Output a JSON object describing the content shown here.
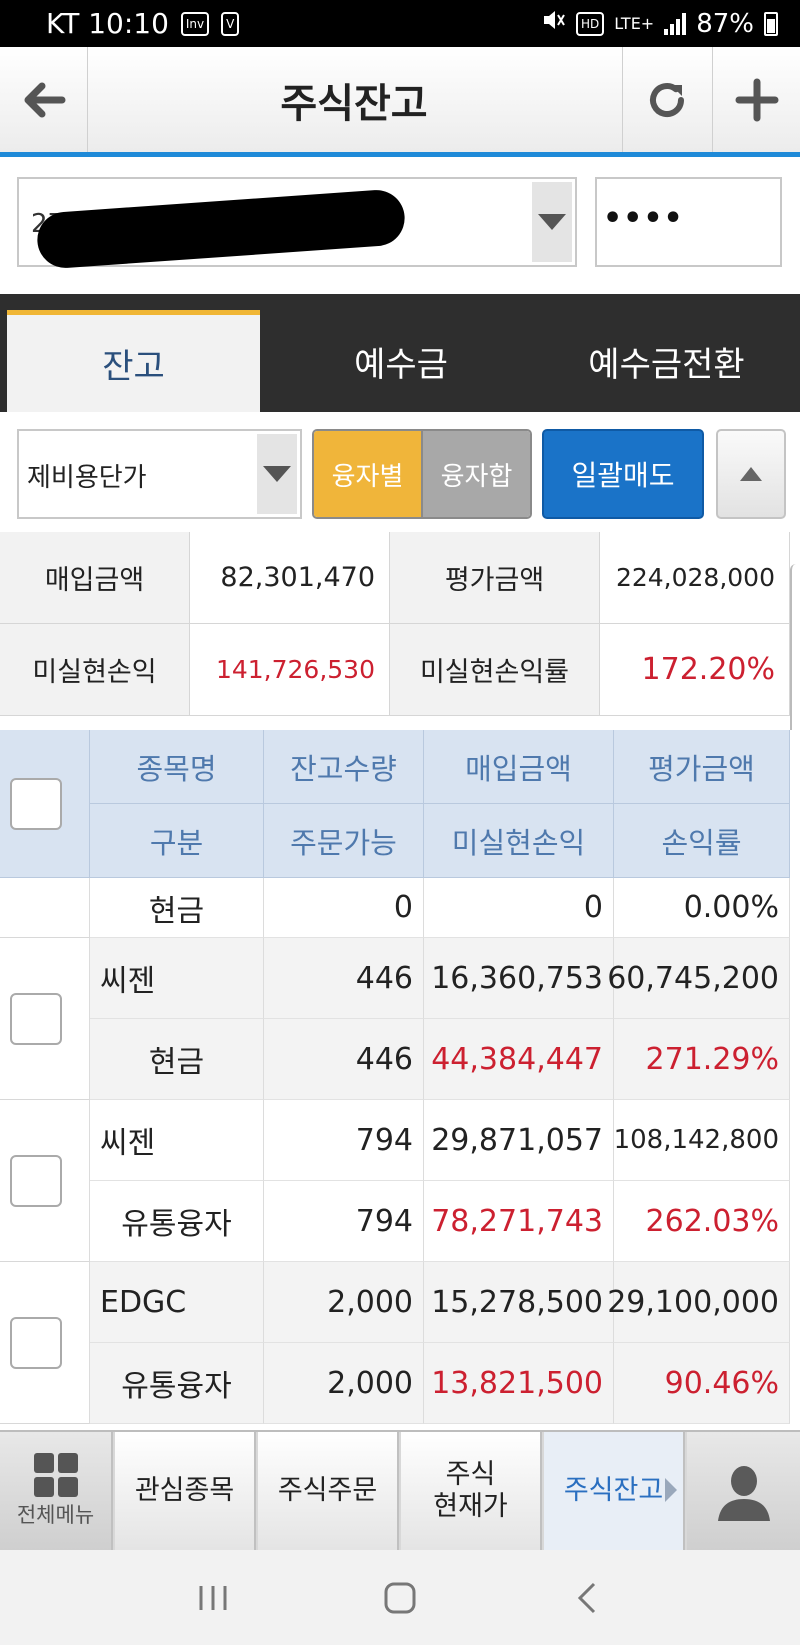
{
  "status_bar": {
    "carrier_time": "KT 10:10",
    "icon_inv": "Inv",
    "icon_v": "V",
    "icon_hd": "HD",
    "network": "LTE+",
    "battery": "87%"
  },
  "header": {
    "title": "주식잔고"
  },
  "account": {
    "number_prefix": "27",
    "password_mask": "••••"
  },
  "tabs": [
    {
      "label": "잔고",
      "active": true
    },
    {
      "label": "예수금",
      "active": false
    },
    {
      "label": "예수금전환",
      "active": false
    }
  ],
  "filters": {
    "price_basis": "제비용단가",
    "seg_by_loan": "융자별",
    "seg_sum_loan": "융자합",
    "bulk_sell": "일괄매도"
  },
  "summary": {
    "purchase_label": "매입금액",
    "purchase_value": "82,301,470",
    "eval_label": "평가금액",
    "eval_value": "224,028,000",
    "unrealized_label": "미실현손익",
    "unrealized_value": "141,726,530",
    "rate_label": "미실현손익률",
    "rate_value": "172.20%"
  },
  "table": {
    "headers_top": [
      "종목명",
      "잔고수량",
      "매입금액",
      "평가금액"
    ],
    "headers_bottom": [
      "구분",
      "주문가능",
      "미실현손익",
      "손익률"
    ],
    "partial_row": {
      "type": "현금",
      "orderable": "0",
      "pnl": "0",
      "rate": "0.00%"
    },
    "rows": [
      {
        "name": "씨젠",
        "qty": "446",
        "purchase": "16,360,753",
        "eval": "60,745,200",
        "type": "현금",
        "orderable": "446",
        "pnl": "44,384,447",
        "rate": "271.29%"
      },
      {
        "name": "씨젠",
        "qty": "794",
        "purchase": "29,871,057",
        "eval": "108,142,800",
        "type": "유통융자",
        "orderable": "794",
        "pnl": "78,271,743",
        "rate": "262.03%"
      },
      {
        "name": "EDGC",
        "qty": "2,000",
        "purchase": "15,278,500",
        "eval": "29,100,000",
        "type": "유통융자",
        "orderable": "2,000",
        "pnl": "13,821,500",
        "rate": "90.46%"
      }
    ]
  },
  "bottom_nav": {
    "menu": "전체메뉴",
    "watchlist": "관심종목",
    "order": "주식주문",
    "price_line1": "주식",
    "price_line2": "현재가",
    "balance": "주식잔고"
  },
  "colors": {
    "accent_blue": "#1f8ad8",
    "tab_active_border": "#f0b636",
    "loss_profit_red": "#cc2030",
    "bulk_sell_blue": "#1a73c8"
  }
}
